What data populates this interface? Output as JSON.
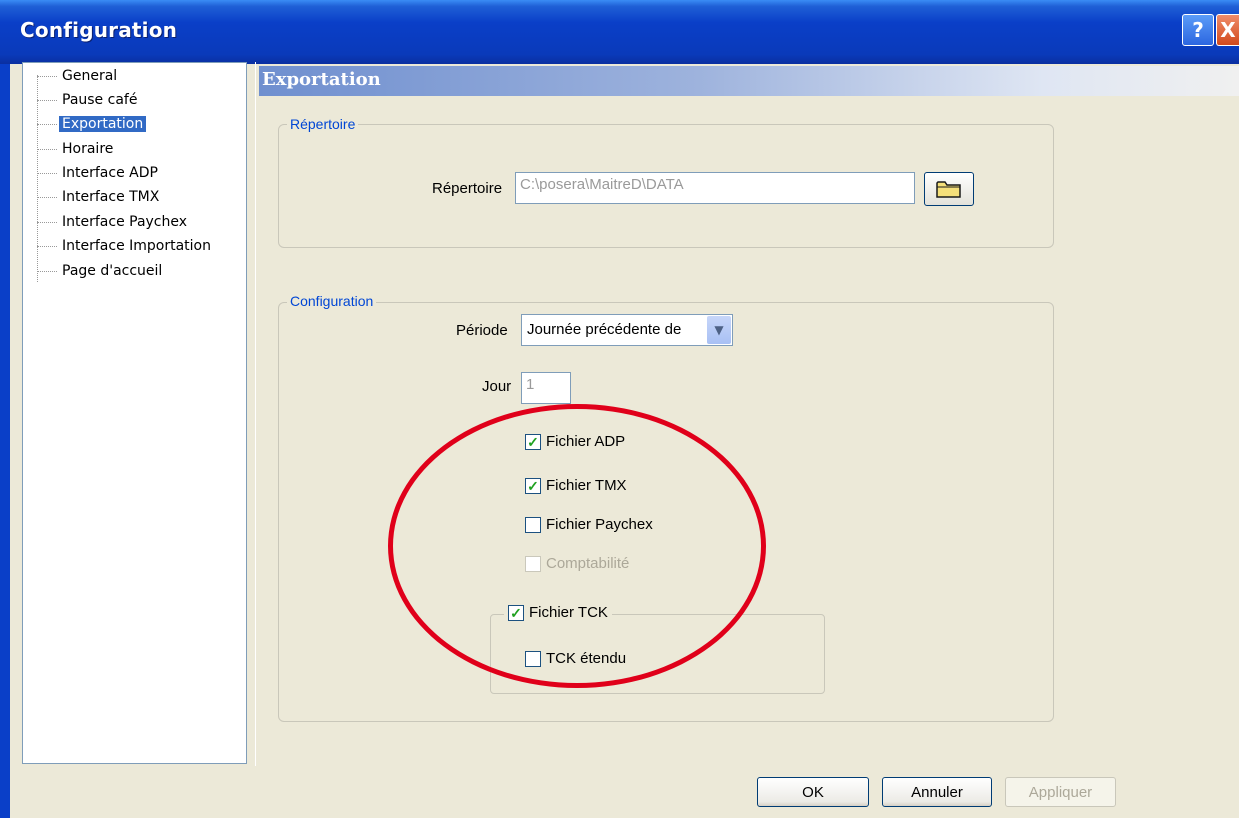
{
  "window": {
    "title": "Configuration",
    "help_glyph": "?",
    "close_glyph": "X"
  },
  "tree": {
    "items": [
      {
        "label": "General",
        "selected": false
      },
      {
        "label": "Pause café",
        "selected": false
      },
      {
        "label": "Exportation",
        "selected": true
      },
      {
        "label": "Horaire",
        "selected": false
      },
      {
        "label": "Interface ADP",
        "selected": false
      },
      {
        "label": "Interface TMX",
        "selected": false
      },
      {
        "label": "Interface Paychex",
        "selected": false
      },
      {
        "label": "Interface Importation",
        "selected": false
      },
      {
        "label": "Page d'accueil",
        "selected": false
      }
    ]
  },
  "page": {
    "title": "Exportation",
    "repertoire_group": {
      "legend": "Répertoire",
      "field_label": "Répertoire",
      "field_value": "C:\\posera\\MaitreD\\DATA",
      "browse_icon": "folder-icon"
    },
    "config_group": {
      "legend": "Configuration",
      "periode_label": "Période",
      "periode_value": "Journée précédente de",
      "jour_label": "Jour",
      "jour_value": "1",
      "checkboxes": [
        {
          "label": "Fichier ADP",
          "checked": true,
          "enabled": true
        },
        {
          "label": "Fichier TMX",
          "checked": true,
          "enabled": true
        },
        {
          "label": "Fichier Paychex",
          "checked": false,
          "enabled": true
        },
        {
          "label": "Comptabilité",
          "checked": false,
          "enabled": false
        }
      ],
      "tck_group": {
        "label": "Fichier TCK",
        "checked": true,
        "etendu_label": "TCK étendu",
        "etendu_checked": false
      }
    }
  },
  "buttons": {
    "ok": "OK",
    "cancel": "Annuler",
    "apply": "Appliquer"
  },
  "colors": {
    "annotation_ellipse": "#e0001a",
    "check": "#21a121",
    "selection": "#316ac5"
  }
}
